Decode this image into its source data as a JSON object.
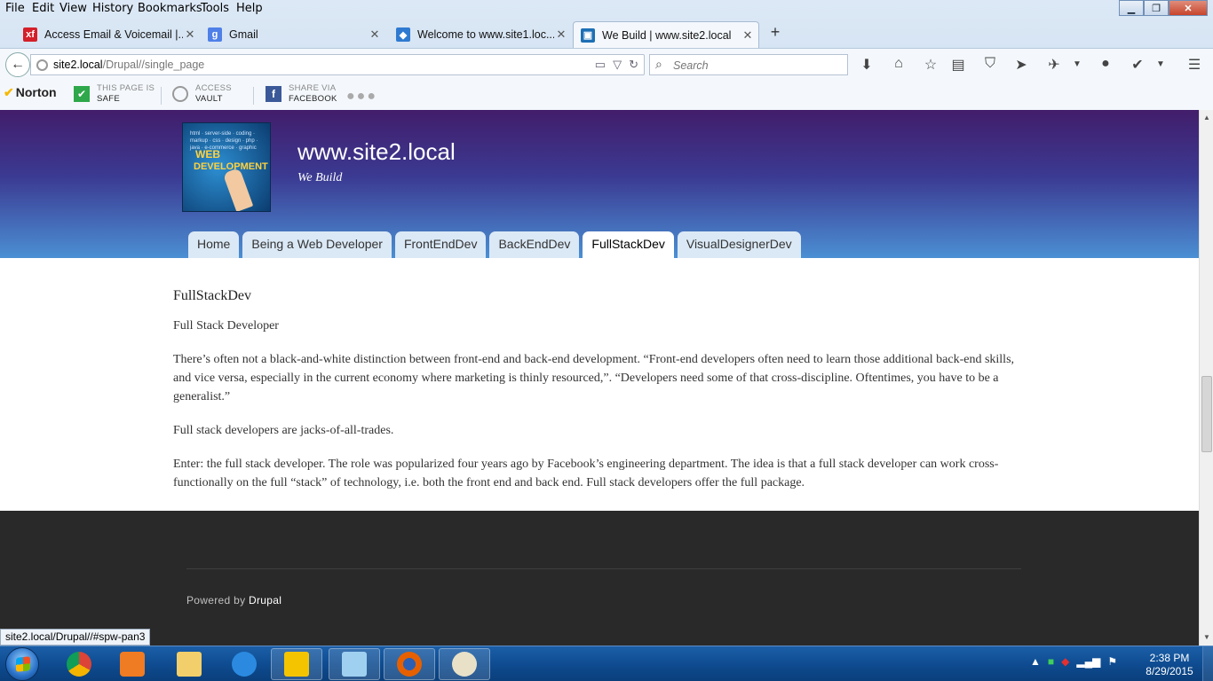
{
  "menu": [
    "File",
    "Edit",
    "View",
    "History",
    "Bookmarks",
    "Tools",
    "Help"
  ],
  "tabs": [
    {
      "title": "Access Email & Voicemail |...",
      "icon": "xfinity-icon",
      "color": "#d4202a",
      "glyph": "xf"
    },
    {
      "title": "Gmail",
      "icon": "google-icon",
      "color": "#4f80e8",
      "glyph": "g"
    },
    {
      "title": "Welcome to www.site1.loc...",
      "icon": "drupal-icon",
      "color": "#2f7ad0",
      "glyph": "◆"
    },
    {
      "title": "We Build | www.site2.local",
      "icon": "site-icon",
      "color": "#1d6fb5",
      "glyph": "▣"
    }
  ],
  "url": {
    "host": "site2.local",
    "path": "/Drupal//single_page"
  },
  "search": {
    "placeholder": "Search"
  },
  "norton": {
    "brand": "Norton",
    "safe_l1": "THIS PAGE IS",
    "safe_l2": "SAFE",
    "vault_l1": "ACCESS",
    "vault_l2": "VAULT",
    "share_l1": "SHARE VIA",
    "share_l2": "FACEBOOK"
  },
  "site": {
    "name": "www.site2.local",
    "slogan": "We Build"
  },
  "nav": [
    "Home",
    "Being a Web Developer",
    "FrontEndDev",
    "BackEndDev",
    "FullStackDev",
    "VisualDesignerDev"
  ],
  "article": {
    "title": "FullStackDev",
    "paragraphs": [
      "Full Stack Developer",
      "There’s often not a black-and-white distinction between front-end and back-end development. “Front-end developers often need to learn those additional back-end skills, and vice versa, especially in the current economy where marketing is thinly resourced,”. “Developers need some of that cross-discipline. Oftentimes, you have to be a generalist.”",
      "Full stack developers are jacks-of-all-trades.",
      "Enter: the full stack developer. The role was popularized four years ago by Facebook’s engineering department. The idea is that a full stack developer can work cross-functionally on the full “stack” of technology, i.e. both the front end and back end. Full stack developers offer the full package."
    ]
  },
  "footer": {
    "powered_prefix": "Powered by",
    "powered_link": "Drupal"
  },
  "status_url": "site2.local/Drupal//#spw-pan3",
  "clock": {
    "time": "2:38 PM",
    "date": "8/29/2015"
  },
  "colors": {
    "header_top": "#421d6b",
    "header_bottom": "#4b8fd3",
    "footer_bg": "#292929",
    "taskbar": "#0f4c91"
  }
}
